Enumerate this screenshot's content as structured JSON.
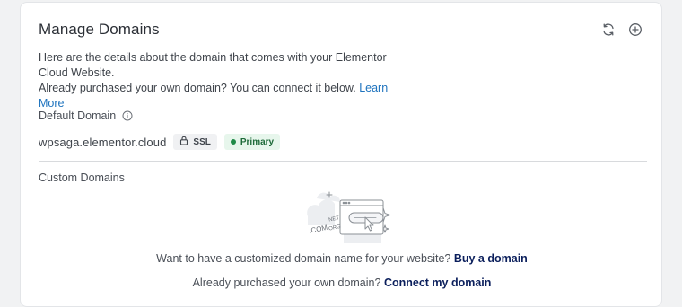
{
  "card": {
    "title": "Manage Domains",
    "refresh_icon": "refresh-icon",
    "add_icon": "plus-circle-icon"
  },
  "description": {
    "line1": "Here are the details about the domain that comes with your Elementor Cloud Website.",
    "line2": "Already purchased your own domain? You can connect it below.",
    "learn_more": "Learn More"
  },
  "default_domain": {
    "label": "Default Domain",
    "info_icon": "info-icon",
    "domain": "wpsaga.elementor.cloud",
    "ssl_label": "SSL",
    "ssl_icon": "lock-icon",
    "primary_label": "Primary"
  },
  "custom_domains": {
    "label": "Custom Domains",
    "illustration_tlds": [
      ".NET",
      ".COM",
      ".ORG"
    ],
    "prompt_buy": "Want to have a customized domain name for your website?",
    "buy_link": "Buy a domain",
    "prompt_connect": "Already purchased your own domain?",
    "connect_link": "Connect my domain"
  },
  "colors": {
    "link": "#1e73be",
    "strong_link": "#0b1f5c",
    "primary_badge_bg": "#e7f6ec",
    "primary_dot": "#1f8a47"
  }
}
